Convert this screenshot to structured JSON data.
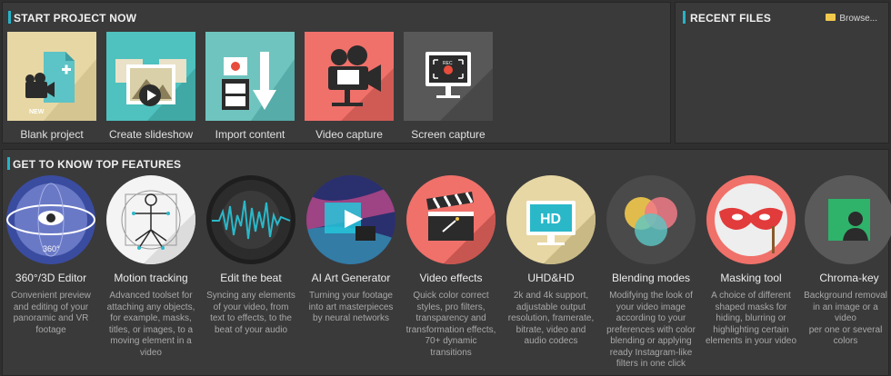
{
  "start": {
    "title": "START PROJECT NOW"
  },
  "recent": {
    "title": "RECENT FILES",
    "browse_label": "Browse..."
  },
  "tiles": [
    {
      "label": "Blank project",
      "icon": "new-project-icon",
      "bg": "#e7d7a4",
      "badge": "NEW"
    },
    {
      "label": "Create slideshow",
      "icon": "slideshow-icon",
      "bg": "#4fc1be"
    },
    {
      "label": "Import content",
      "icon": "import-icon",
      "bg": "#6fc4bf"
    },
    {
      "label": "Video capture",
      "icon": "video-camera-icon",
      "bg": "#f0716a"
    },
    {
      "label": "Screen capture",
      "icon": "screen-capture-icon",
      "bg": "#585858",
      "badge": "REC"
    }
  ],
  "features": {
    "title": "GET TO KNOW TOP FEATURES",
    "items": [
      {
        "name": "360°/3D Editor",
        "desc": [
          "Convenient preview",
          "and editing of your",
          "panoramic and VR",
          "footage"
        ],
        "icon": "360-editor-icon",
        "bg": "#3a4ca0",
        "badge": "360°"
      },
      {
        "name": "Motion tracking",
        "desc": [
          "Advanced toolset for",
          "attaching any objects,",
          "for example, masks,",
          "titles, or images, to a",
          "moving element in a",
          "video"
        ],
        "icon": "motion-tracking-icon",
        "bg": "#f4f4f4"
      },
      {
        "name": "Edit the beat",
        "desc": [
          "Syncing any elements",
          "of your video, from",
          "text to effects, to the",
          "beat of your audio"
        ],
        "icon": "beat-waveform-icon",
        "bg": "#1e1e1e"
      },
      {
        "name": "AI Art Generator",
        "desc": [
          "Turning your footage",
          "into art masterpieces",
          "by neural networks"
        ],
        "icon": "ai-art-icon",
        "bg": "#3b3f8c"
      },
      {
        "name": "Video effects",
        "desc": [
          "Quick color correct",
          "styles, pro filters,",
          "transparency and",
          "transformation effects,",
          "70+ dynamic",
          "transitions"
        ],
        "icon": "clapperboard-icon",
        "bg": "#f0716a"
      },
      {
        "name": "UHD&HD",
        "desc": [
          "2k and 4k support,",
          "adjustable output",
          "resolution, framerate,",
          "bitrate, video and",
          "audio codecs"
        ],
        "icon": "hd-monitor-icon",
        "bg": "#e7d7a4",
        "badge": "HD"
      },
      {
        "name": "Blending modes",
        "desc": [
          "Modifying the look of",
          "your video image",
          "according to your",
          "preferences with color",
          "blending or applying",
          "ready Instagram-like",
          "filters in one click"
        ],
        "icon": "blending-circles-icon",
        "bg": "#4a4a4a"
      },
      {
        "name": "Masking tool",
        "desc": [
          "A choice of different",
          "shaped masks for",
          "hiding, blurring or",
          "highlighting certain",
          "elements in your video"
        ],
        "icon": "mask-icon",
        "bg": "#f0716a"
      },
      {
        "name": "Chroma-key",
        "desc": [
          "Background removal",
          "in an image or a video",
          "per one or several",
          "colors"
        ],
        "icon": "chroma-key-icon",
        "bg": "#5a5a5a"
      }
    ]
  }
}
